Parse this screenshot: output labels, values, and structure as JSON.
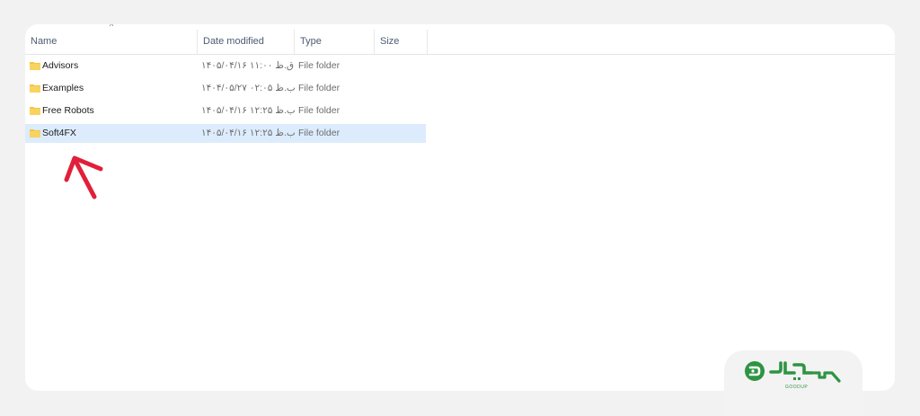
{
  "columns": {
    "name": "Name",
    "date_modified": "Date modified",
    "type": "Type",
    "size": "Size"
  },
  "rows": [
    {
      "name": "Advisors",
      "date": "۱۴۰۵/۰۴/۱۶ ق.ظ ۱۱:۰۰",
      "type": "File folder",
      "selected": false
    },
    {
      "name": "Examples",
      "date": "۱۴۰۴/۰۵/۲۷ ب.ظ ۰۲:۰۵",
      "type": "File folder",
      "selected": false
    },
    {
      "name": "Free Robots",
      "date": "۱۴۰۵/۰۴/۱۶ ب.ظ ۱۲:۲۵",
      "type": "File folder",
      "selected": false
    },
    {
      "name": "Soft4FX",
      "date": "۱۴۰۵/۰۴/۱۶ ب.ظ ۱۲:۲۵",
      "type": "File folder",
      "selected": true
    }
  ],
  "logo": {
    "brand": "GOODUP",
    "color": "#2e9444"
  },
  "colors": {
    "selection": "#dcecfc",
    "arrow": "#e21f3a",
    "folder": "#f4c542"
  }
}
